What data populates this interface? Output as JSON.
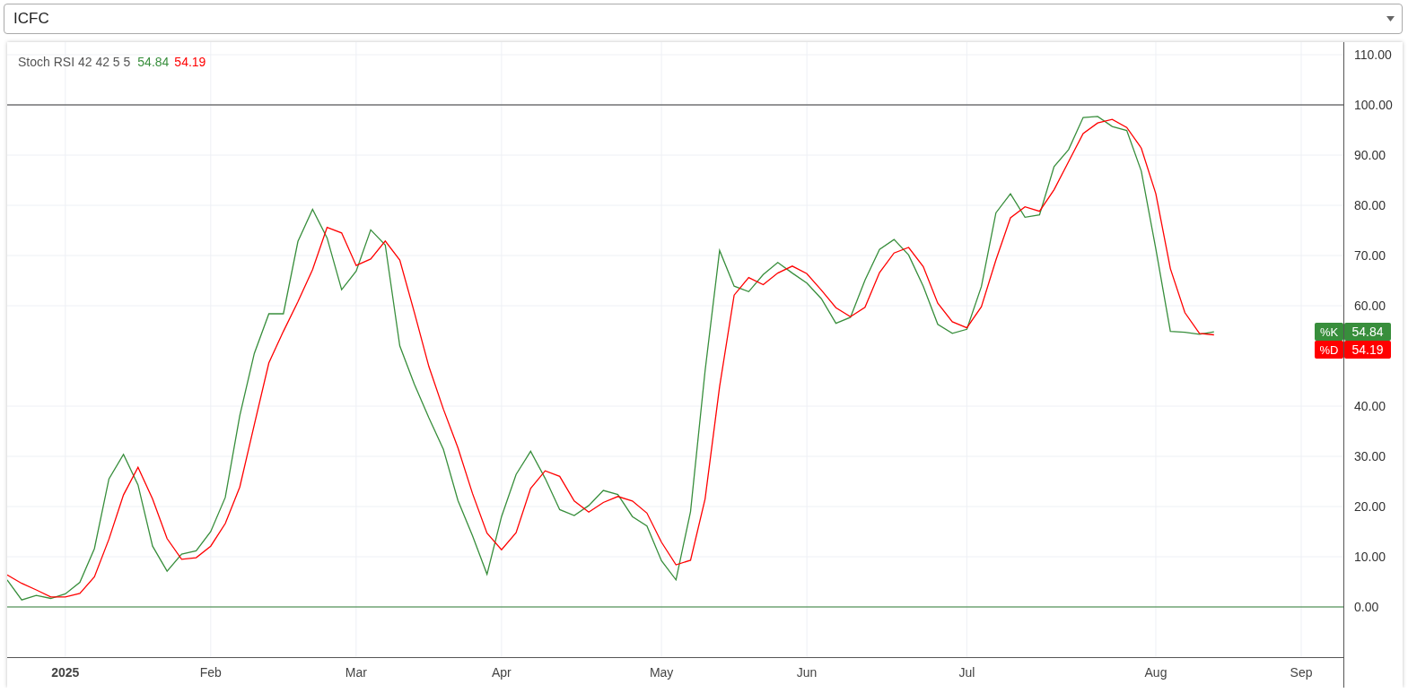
{
  "symbol_select": {
    "value": "ICFC"
  },
  "chart": {
    "legend": {
      "title": "Stoch RSI 42 42 5 5",
      "values": [
        "54.84",
        "54.19"
      ]
    },
    "price_tags": [
      {
        "value": "54.84"
      },
      {
        "value": "54.19"
      }
    ],
    "chart_data": {
      "type": "line",
      "ylim": [
        -10,
        112.5
      ],
      "yticks": [
        {
          "value": 0,
          "label": "0.00"
        },
        {
          "value": 10,
          "label": "10.00"
        },
        {
          "value": 20,
          "label": "20.00"
        },
        {
          "value": 30,
          "label": "30.00"
        },
        {
          "value": 40,
          "label": "40.00"
        },
        {
          "value": 60,
          "label": "60.00"
        },
        {
          "value": 70,
          "label": "70.00"
        },
        {
          "value": 80,
          "label": "80.00"
        },
        {
          "value": 90,
          "label": "90.00"
        },
        {
          "value": 100,
          "label": "100.00"
        },
        {
          "value": 110,
          "label": "110.00"
        }
      ],
      "categories": [
        null,
        null,
        null,
        null,
        "2025",
        null,
        null,
        null,
        null,
        null,
        null,
        null,
        null,
        null,
        "Feb",
        null,
        null,
        null,
        null,
        null,
        null,
        null,
        null,
        null,
        "Mar",
        null,
        null,
        null,
        null,
        null,
        null,
        null,
        null,
        null,
        "Apr",
        null,
        null,
        null,
        null,
        null,
        null,
        null,
        null,
        null,
        null,
        "May",
        null,
        null,
        null,
        null,
        null,
        null,
        null,
        null,
        null,
        "Jun",
        null,
        null,
        null,
        null,
        null,
        null,
        null,
        null,
        null,
        null,
        "Jul",
        null,
        null,
        null,
        null,
        null,
        null,
        null,
        null,
        null,
        null,
        null,
        null,
        "Aug",
        null,
        null,
        null,
        null,
        null,
        null,
        null,
        null,
        null,
        "Sep",
        null,
        null
      ],
      "grid": true,
      "legend": true,
      "ref_lines": [
        {
          "axis": "y",
          "value": 100,
          "color": "#333333"
        },
        {
          "axis": "y",
          "value": 0,
          "color": "#2e7d32"
        }
      ],
      "series": [
        {
          "name": "%K",
          "color": "#388e3c",
          "values": [
            5.4,
            1.4,
            2.3,
            1.7,
            2.6,
            4.9,
            11.6,
            25.5,
            30.4,
            24.3,
            12.1,
            7.1,
            10.5,
            11.2,
            15,
            21.8,
            38.1,
            50.5,
            58.4,
            58.4,
            72.8,
            79.2,
            73.5,
            63.2,
            66.9,
            75.1,
            72.1,
            52,
            44.4,
            37.7,
            31.4,
            21.2,
            14.2,
            6.5,
            18,
            26.4,
            31,
            25.6,
            19.4,
            18.2,
            20.2,
            23.2,
            22.4,
            18,
            16.1,
            9.2,
            5.4,
            19,
            47,
            71,
            63.9,
            62.8,
            66.2,
            68.6,
            66.5,
            64.5,
            61.4,
            56.5,
            57.7,
            65.1,
            71.2,
            73.2,
            70.1,
            63.9,
            56.3,
            54.5,
            55.3,
            63.8,
            78.5,
            82.3,
            77.6,
            78.1,
            87.7,
            91.1,
            97.5,
            97.7,
            95.7,
            94.9,
            86.8,
            71.3,
            54.9,
            54.7,
            54.3,
            54.8,
            null,
            null,
            null,
            null,
            null,
            null,
            null,
            null
          ]
        },
        {
          "name": "%D",
          "color": "#ff0000",
          "values": [
            6.4,
            4.7,
            3.4,
            2,
            2,
            2.7,
            6,
            13.5,
            22.3,
            27.8,
            21.5,
            13.6,
            9.5,
            9.8,
            12.1,
            16.6,
            23.9,
            36.3,
            48.6,
            54.9,
            60.8,
            67.2,
            75.6,
            74.5,
            68,
            69.3,
            72.9,
            69.1,
            58.7,
            47.9,
            39.4,
            31.7,
            22.6,
            14.7,
            11.4,
            14.8,
            23.6,
            27.1,
            26,
            21.1,
            18.9,
            20.8,
            22,
            21.1,
            18.7,
            12.9,
            8.4,
            9.3,
            21.5,
            43.9,
            62.1,
            65.6,
            64.2,
            66.5,
            67.9,
            66.4,
            63.1,
            59.6,
            57.8,
            59.7,
            66.6,
            70.5,
            71.6,
            67.8,
            60.5,
            56.8,
            55.6,
            59.8,
            69.1,
            77.5,
            79.7,
            78.8,
            83.1,
            88.7,
            94.3,
            96.4,
            97.1,
            95.5,
            91.4,
            82.3,
            67.4,
            58.6,
            54.5,
            54.2,
            null,
            null,
            null,
            null,
            null,
            null,
            null,
            null
          ]
        }
      ]
    }
  }
}
